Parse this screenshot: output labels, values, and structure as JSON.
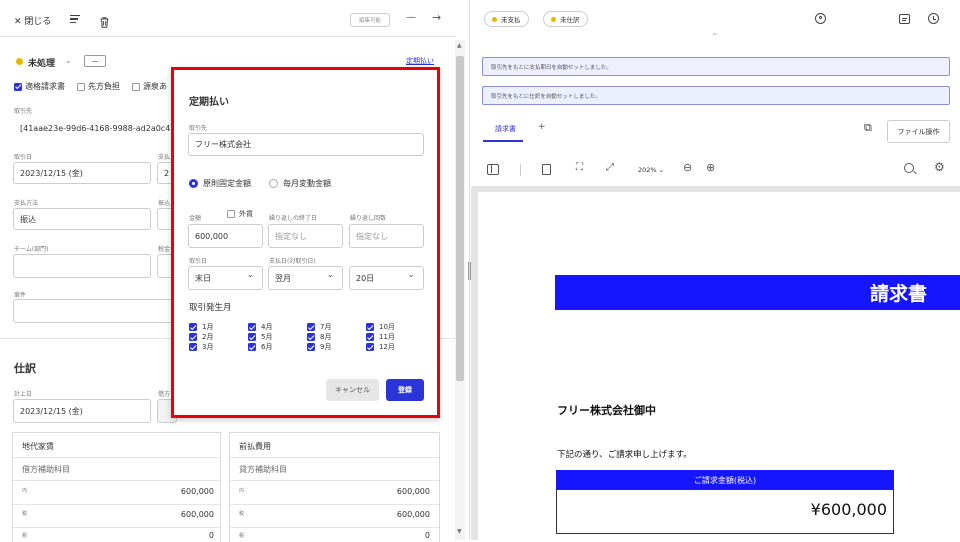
{
  "toolbar": {
    "close_label": "閉じる",
    "editable_badge": "編集可能"
  },
  "status": {
    "label": "未処理",
    "dropdown": "—",
    "periodic_link": "定期払い"
  },
  "checkboxes": {
    "qualified_invoice": "適格請求書",
    "prepaid": "先方負担",
    "withholding": "源泉あ"
  },
  "fields": {
    "partner_label": "取引先",
    "partner_value": "[41aae23e-99d6-4168-9988-ad2a0c477",
    "date_label": "取引日",
    "date_value": "2023/12/15 (金)",
    "due_partial_label": "支払",
    "due_partial_value": "2",
    "method_label": "支払方法",
    "method_value": "振込",
    "account_partial": "振込",
    "team_label": "チーム(部門)",
    "tax_partial": "税金",
    "project_label": "案件"
  },
  "journal": {
    "heading": "仕訳",
    "posting_label": "計上日",
    "posting_value": "2023/12/15 (金)",
    "credit_partial": "借方",
    "left_account": "地代家賃",
    "left_sub": "借方補助科目",
    "right_account": "前払費用",
    "right_sub": "貸方補助科目",
    "rows": [
      {
        "tag": "内",
        "left": "600,000",
        "right": "600,000"
      },
      {
        "tag": "税",
        "left": "600,000",
        "right": "600,000"
      },
      {
        "tag": "税",
        "left": "0",
        "right": "0"
      }
    ]
  },
  "modal": {
    "title": "定期払い",
    "partner_label": "取引先",
    "partner_value": "フリー株式会社",
    "radio_fixed": "原則固定金額",
    "radio_variable": "毎月変動金額",
    "amount_label": "金額",
    "foreign_label": "外貨",
    "repeat_end_label": "繰り返しの終了日",
    "repeat_count_label": "繰り返し回数",
    "amount_value": "600,000",
    "repeat_end_placeholder": "指定なし",
    "repeat_count_placeholder": "指定なし",
    "trade_day_label": "取引日",
    "pay_day_label": "支払日(対取引日)",
    "trade_day_value": "末日",
    "pay_month_value": "翌月",
    "pay_day_value": "20日",
    "months_label": "取引発生月",
    "months": [
      "1月",
      "2月",
      "3月",
      "4月",
      "5月",
      "6月",
      "7月",
      "8月",
      "9月",
      "10月",
      "11月",
      "12月"
    ],
    "cancel_label": "キャンセル",
    "submit_label": "登録"
  },
  "right": {
    "tag_unpaid": "未支払",
    "tag_unjournal": "未仕訳",
    "notice1": "取引先をもとに支払期日を自動セットしました。",
    "notice2": "取引先をもとに仕訳を自動セットしました。",
    "tab_invoice": "請求書",
    "tab_add": "+",
    "file_ops": "ファイル操作",
    "zoom": "202%"
  },
  "invoice": {
    "title": "請求書",
    "addressee": "フリー株式会社御中",
    "greeting": "下記の通り、ご請求申し上げます。",
    "amount_header": "ご請求金額(税込)",
    "amount": "¥600,000"
  },
  "colors": {
    "accent": "#2b34d6",
    "invoice_blue": "#1515ff",
    "modal_border": "#e8000b",
    "status_dot": "#e8b800"
  }
}
